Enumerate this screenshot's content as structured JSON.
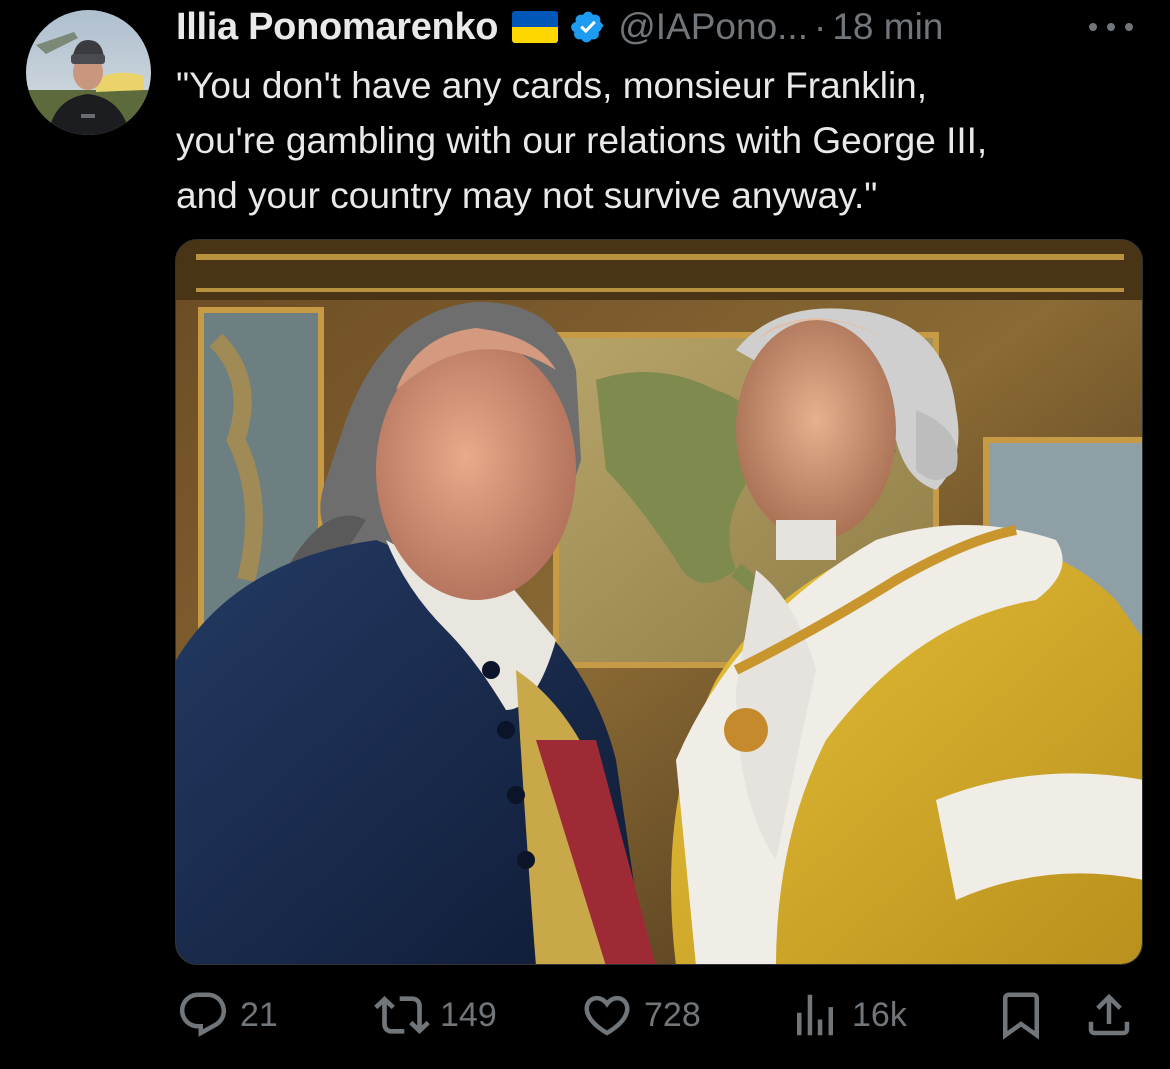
{
  "tweet": {
    "author": {
      "display_name": "Illia Ponomarenko",
      "flag_icon": "ukraine-flag-icon",
      "verified_icon": "verified-badge-icon",
      "handle": "@IAPono...",
      "separator": "·",
      "time": "18 min"
    },
    "text_lines": [
      "\"You don't have any cards, monsieur Franklin,",
      "you're gambling with our relations with George III,",
      "and your country may not survive anyway.\""
    ]
  },
  "actions": {
    "replies": {
      "icon": "reply-icon",
      "count": "21"
    },
    "reposts": {
      "icon": "repost-icon",
      "count": "149"
    },
    "likes": {
      "icon": "heart-icon",
      "count": "728"
    },
    "views": {
      "icon": "views-icon",
      "count": "16k"
    },
    "bookmark": {
      "icon": "bookmark-icon"
    },
    "share": {
      "icon": "share-icon"
    }
  },
  "colors": {
    "background": "#000000",
    "text": "#e7e9ea",
    "muted": "#71767b",
    "verified_blue": "#1d9bf0",
    "flag_blue": "#0057b7",
    "flag_yellow": "#ffd700"
  }
}
